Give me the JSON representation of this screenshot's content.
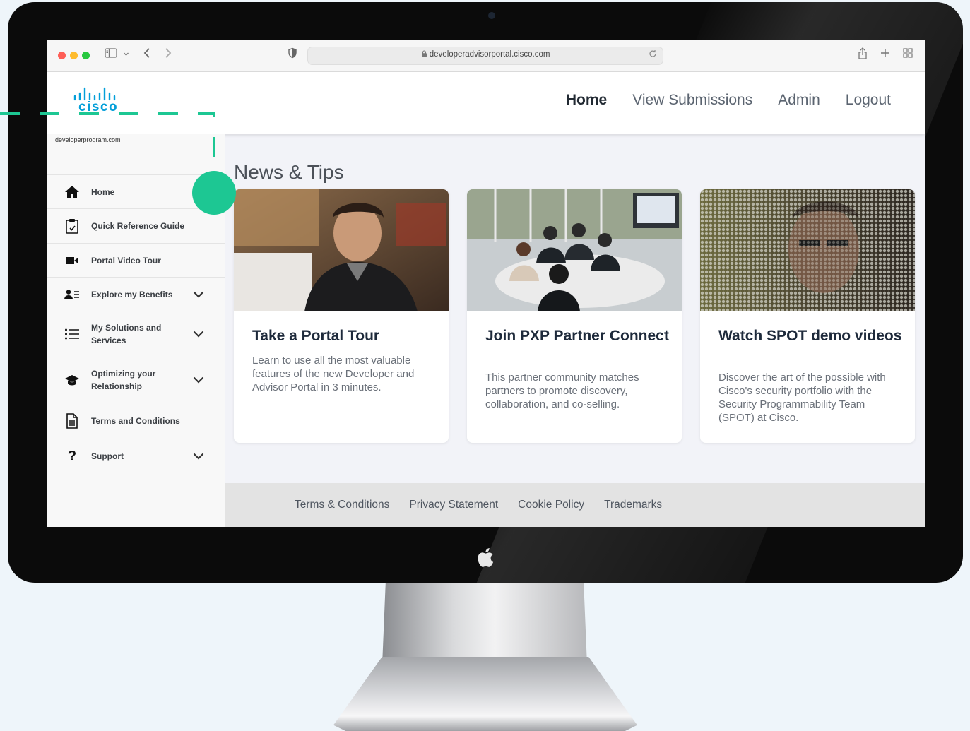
{
  "browser": {
    "url": "developeradvisorportal.cisco.com"
  },
  "site": {
    "logo_text": "cisco",
    "domain_label": "developerprogram.com"
  },
  "nav": {
    "items": [
      {
        "label": "Home",
        "active": true
      },
      {
        "label": "View Submissions",
        "active": false
      },
      {
        "label": "Admin",
        "active": false
      },
      {
        "label": "Logout",
        "active": false
      }
    ]
  },
  "sidebar": {
    "items": [
      {
        "label": "Home",
        "icon": "home-icon",
        "expandable": false
      },
      {
        "label": "Quick Reference Guide",
        "icon": "clipboard-icon",
        "expandable": false
      },
      {
        "label": "Portal Video Tour",
        "icon": "video-camera-icon",
        "expandable": false
      },
      {
        "label": "Explore my Benefits",
        "icon": "user-list-icon",
        "expandable": true
      },
      {
        "label": "My Solutions and Services",
        "icon": "list-icon",
        "expandable": true
      },
      {
        "label": "Optimizing your Relationship",
        "icon": "graduation-cap-icon",
        "expandable": true
      },
      {
        "label": "Terms and Conditions",
        "icon": "document-icon",
        "expandable": false
      },
      {
        "label": "Support",
        "icon": "question-icon",
        "expandable": true
      }
    ]
  },
  "main": {
    "section_title": "News & Tips",
    "cards": [
      {
        "title": "Take a Portal Tour",
        "description": "Learn to use all the most valuable features of the new Developer and Advisor Portal in 3 minutes."
      },
      {
        "title": "Join PXP Partner Connect",
        "description": "This partner community matches partners to promote discovery, collaboration, and co-selling."
      },
      {
        "title": "Watch SPOT demo videos",
        "description": "Discover the art of the possible with Cisco's security portfolio with the Security Programmability Team (SPOT) at Cisco."
      }
    ]
  },
  "footer": {
    "links": [
      "Terms & Conditions",
      "Privacy Statement",
      "Cookie Policy",
      "Trademarks"
    ]
  },
  "colors": {
    "cisco_blue": "#049fd9",
    "annotation_green": "#1dc793"
  }
}
